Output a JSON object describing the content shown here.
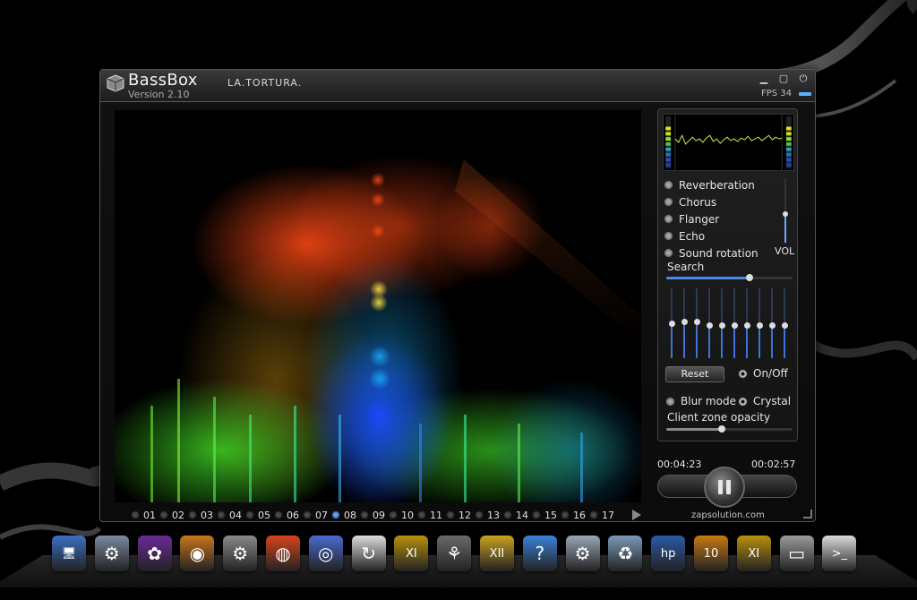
{
  "window": {
    "title": "BassBox",
    "subtitle": "LA.TORTURA.",
    "version": "Version 2.10",
    "fps": "FPS 34",
    "minimize_icon": "minimize-icon",
    "maximize_icon": "maximize-icon",
    "power_icon": "power-icon"
  },
  "effects": [
    {
      "label": "Reverberation"
    },
    {
      "label": "Chorus"
    },
    {
      "label": "Flanger"
    },
    {
      "label": "Echo"
    },
    {
      "label": "Sound rotation"
    }
  ],
  "volume": {
    "label": "VOL",
    "level": 0.45
  },
  "search": {
    "label": "Search",
    "position": 0.66
  },
  "equalizer": {
    "bands": [
      0.5,
      0.53,
      0.53,
      0.48,
      0.48,
      0.48,
      0.48,
      0.48,
      0.48,
      0.48
    ]
  },
  "controls": {
    "reset_label": "Reset",
    "onoff_label": "On/Off",
    "blur_label": "Blur mode",
    "crystal_label": "Crystal",
    "opacity_label": "Client zone opacity",
    "opacity_level": 0.44
  },
  "playback": {
    "elapsed": "00:04:23",
    "remaining": "00:02:57",
    "brand": "zapsolution.com"
  },
  "tracks": [
    "01",
    "02",
    "03",
    "04",
    "05",
    "06",
    "07",
    "08",
    "09",
    "10",
    "11",
    "12",
    "13",
    "14",
    "15",
    "16",
    "17"
  ],
  "active_track": "08",
  "dock": [
    {
      "icon": "computer-icon",
      "color": "#3b6fc4",
      "glyph": "🖥"
    },
    {
      "icon": "settings-doc-icon",
      "color": "#7a8aa0",
      "glyph": "⚙"
    },
    {
      "icon": "picasa-icon",
      "color": "#6a2a9a",
      "glyph": "✿"
    },
    {
      "icon": "disc-burner-icon",
      "color": "#c8761c",
      "glyph": "◉"
    },
    {
      "icon": "gears-icon",
      "color": "#8a8a8a",
      "glyph": "⚙"
    },
    {
      "icon": "firefox-icon",
      "color": "#d8441a",
      "glyph": "◍"
    },
    {
      "icon": "speaker-icon",
      "color": "#4a6ad0",
      "glyph": "◎"
    },
    {
      "icon": "refresh-icon",
      "color": "#dddddd",
      "glyph": "↻"
    },
    {
      "icon": "windev-xi-icon",
      "color": "#b8900c",
      "glyph": "XI"
    },
    {
      "icon": "film-reel-icon",
      "color": "#6a6a6a",
      "glyph": "⚘"
    },
    {
      "icon": "windev-xii-icon",
      "color": "#c8a020",
      "glyph": "XII"
    },
    {
      "icon": "help-icon",
      "color": "#3a82d8",
      "glyph": "?"
    },
    {
      "icon": "gears-blue-icon",
      "color": "#9aa6b8",
      "glyph": "⚙"
    },
    {
      "icon": "recycle-bin-icon",
      "color": "#7a9ab8",
      "glyph": "♻"
    },
    {
      "icon": "hp-icon",
      "color": "#2a5aa8",
      "glyph": "hp"
    },
    {
      "icon": "windev-10-icon",
      "color": "#c87a10",
      "glyph": "10"
    },
    {
      "icon": "windev-xi-2-icon",
      "color": "#b8900c",
      "glyph": "XI"
    },
    {
      "icon": "drive-icon",
      "color": "#9a9a9a",
      "glyph": "▭"
    },
    {
      "icon": "terminal-icon",
      "color": "#dadada",
      "glyph": ">_"
    }
  ]
}
